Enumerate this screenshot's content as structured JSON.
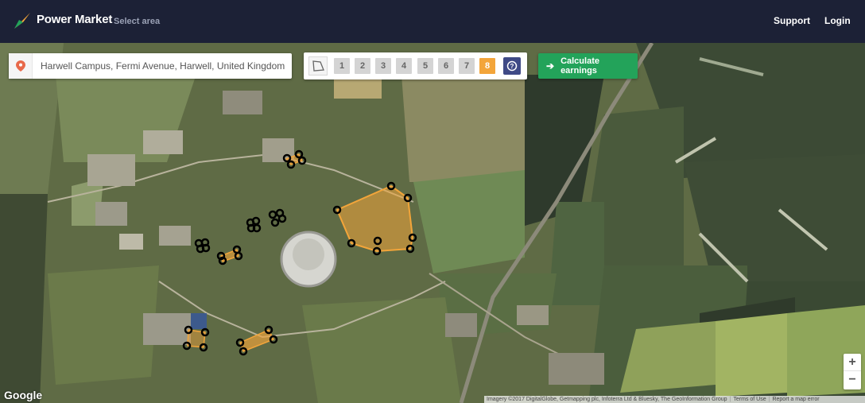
{
  "header": {
    "brand": "Power Market",
    "subtitle": "Select area",
    "nav": {
      "support": "Support",
      "login": "Login"
    }
  },
  "search": {
    "value": "Harwell Campus, Fermi Avenue, Harwell, United Kingdom",
    "icon": "map-pin-icon"
  },
  "area_toolbar": {
    "tool_icon": "polygon-draw-icon",
    "areas": [
      "1",
      "2",
      "3",
      "4",
      "5",
      "6",
      "7",
      "8"
    ],
    "active_area": "8",
    "help_icon": "help-circle-icon"
  },
  "calculate_button": {
    "label": "Calculate earnings",
    "icon": "arrow-right-icon"
  },
  "map": {
    "zoom_in": "+",
    "zoom_out": "−",
    "provider_logo": "Google",
    "attribution": "Imagery ©2017 DigitalGlobe, Getmapping plc, Infoterra Ltd & Bluesky, The GeoInformation Group",
    "terms": "Terms of Use",
    "report": "Report a map error"
  },
  "colors": {
    "topbar": "#1c2136",
    "accent_orange": "#f3a53a",
    "calc_green": "#23a35a",
    "help_blue": "#3f4a86"
  }
}
